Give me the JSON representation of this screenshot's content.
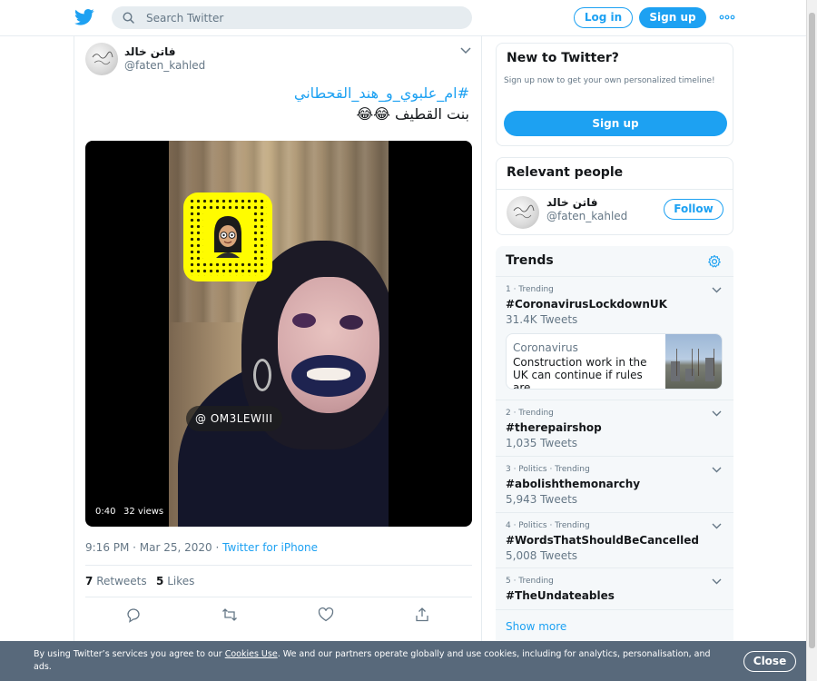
{
  "header": {
    "search": {
      "placeholder": "Search Twitter"
    },
    "login_label": "Log in",
    "signup_label": "Sign up",
    "icons": {
      "logo": "twitter-bird-icon",
      "search": "search-icon",
      "more": "more-dots-icon"
    }
  },
  "tweet": {
    "author_name": "فاتن خالد",
    "author_handle": "@faten_kahled",
    "hashtag": "#ام_علبوي_و_هند_القحطاني",
    "text": "بنت القطيف 😂😂",
    "video": {
      "duration": "0:40",
      "views": "32 views",
      "overlay_handle": "@ OM3LEWIII"
    },
    "time": "9:16 PM · Mar 25, 2020",
    "source": "Twitter for iPhone",
    "retweets_count": "7",
    "retweets_label": "Retweets",
    "likes_count": "5",
    "likes_label": "Likes",
    "action_icons": [
      "reply-icon",
      "retweet-icon",
      "like-icon",
      "share-icon"
    ]
  },
  "new_to_twitter": {
    "title": "New to Twitter?",
    "subtitle": "Sign up now to get your own personalized timeline!",
    "signup_label": "Sign up"
  },
  "relevant_people": {
    "title": "Relevant people",
    "name": "فاتن خالد",
    "handle": "@faten_kahled",
    "follow_label": "Follow"
  },
  "trends": {
    "title": "Trends",
    "items": [
      {
        "meta": "1 · Trending",
        "name": "#CoronavirusLockdownUK",
        "count": "31.4K Tweets"
      },
      {
        "meta": "2 · Trending",
        "name": "#therepairshop",
        "count": "1,035 Tweets"
      },
      {
        "meta": "3 · Politics · Trending",
        "name": "#abolishthemonarchy",
        "count": "5,943 Tweets"
      },
      {
        "meta": "4 · Politics · Trending",
        "name": "#WordsThatShouldBeCancelled",
        "count": "5,008 Tweets"
      },
      {
        "meta": "5 · Trending",
        "name": "#TheUndateables",
        "count": ""
      }
    ],
    "news": {
      "category": "Coronavirus",
      "headline": "Construction work in the UK can continue if rules are ..."
    },
    "show_more": "Show more"
  },
  "cookie_bar": {
    "text_before": "By using Twitter’s services you agree to our ",
    "link": "Cookies Use",
    "text_after": ". We and our partners operate globally and use cookies, including for analytics, personalisation, and ads.",
    "close_label": "Close"
  },
  "colors": {
    "brand": "#1da1f2",
    "text": "#14171a",
    "secondary": "#657786",
    "border": "#e6ecf0",
    "trends_bg": "#f5f8fa",
    "snapcode": "#fffc00"
  }
}
